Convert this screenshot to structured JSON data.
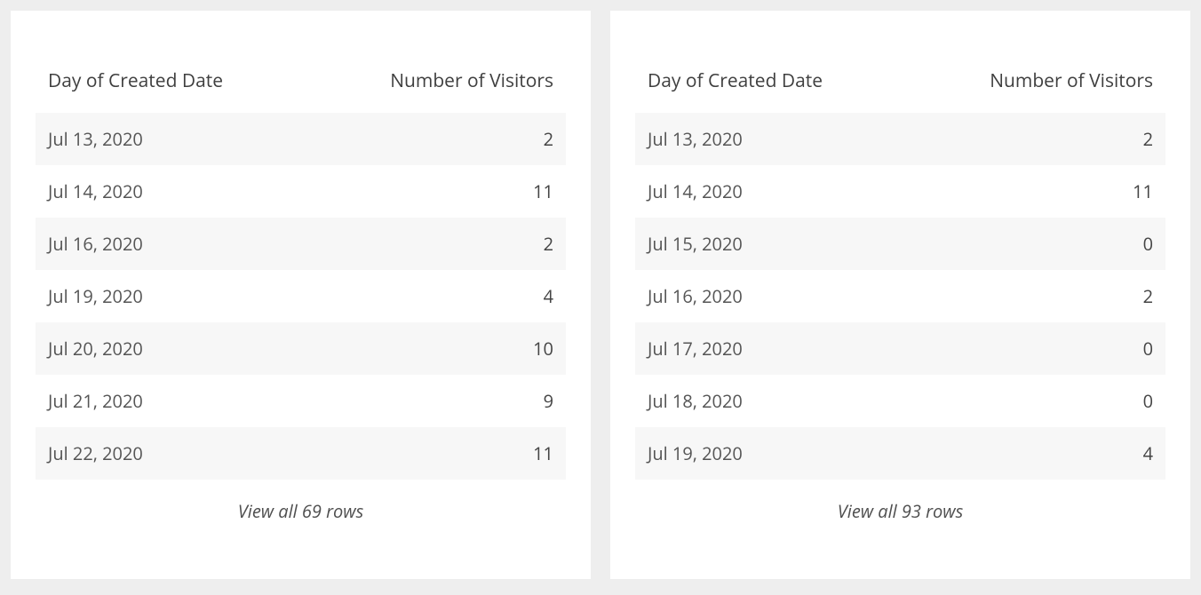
{
  "chart_data": [
    {
      "type": "table",
      "columns": [
        "Day of Created Date",
        "Number of Visitors"
      ],
      "rows": [
        {
          "date": "Jul 13, 2020",
          "visitors": 2
        },
        {
          "date": "Jul 14, 2020",
          "visitors": 11
        },
        {
          "date": "Jul 16, 2020",
          "visitors": 2
        },
        {
          "date": "Jul 19, 2020",
          "visitors": 4
        },
        {
          "date": "Jul 20, 2020",
          "visitors": 10
        },
        {
          "date": "Jul 21, 2020",
          "visitors": 9
        },
        {
          "date": "Jul 22, 2020",
          "visitors": 11
        }
      ],
      "total_rows": 69,
      "view_all_label": "View all 69 rows"
    },
    {
      "type": "table",
      "columns": [
        "Day of Created Date",
        "Number of Visitors"
      ],
      "rows": [
        {
          "date": "Jul 13, 2020",
          "visitors": 2
        },
        {
          "date": "Jul 14, 2020",
          "visitors": 11
        },
        {
          "date": "Jul 15, 2020",
          "visitors": 0
        },
        {
          "date": "Jul 16, 2020",
          "visitors": 2
        },
        {
          "date": "Jul 17, 2020",
          "visitors": 0
        },
        {
          "date": "Jul 18, 2020",
          "visitors": 0
        },
        {
          "date": "Jul 19, 2020",
          "visitors": 4
        }
      ],
      "total_rows": 93,
      "view_all_label": "View all 93 rows"
    }
  ]
}
